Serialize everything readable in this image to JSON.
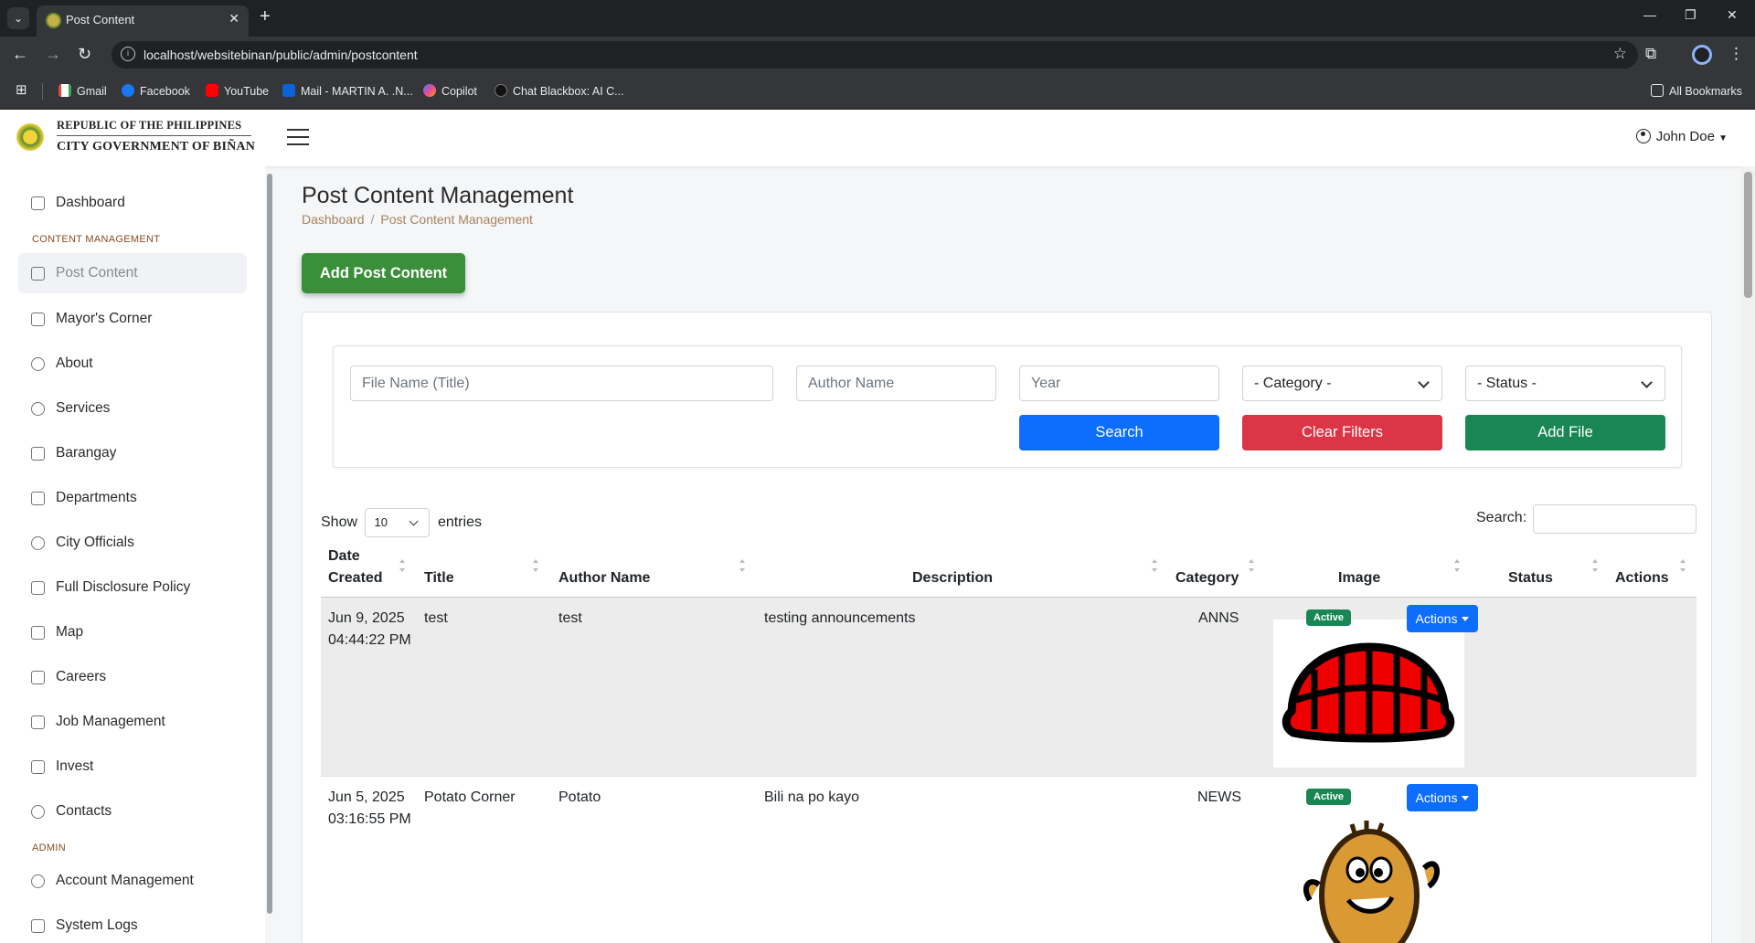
{
  "browser": {
    "tab_title": "Post Content",
    "url": "localhost/websitebinan/public/admin/postcontent",
    "bookmarks": [
      "Gmail",
      "Facebook",
      "YouTube",
      "Mail - MARTIN A. .N...",
      "Copilot",
      "Chat Blackbox: AI C..."
    ],
    "all_bookmarks": "All Bookmarks"
  },
  "header": {
    "brand_line1": "REPUBLIC OF THE PHILIPPINES",
    "brand_line2": "CITY GOVERNMENT OF BIÑAN",
    "user_name": "John Doe"
  },
  "sidebar": {
    "items": [
      {
        "label": "Dashboard",
        "icon": "grid-icon"
      },
      {
        "label": "Post Content",
        "icon": "newspaper-icon"
      },
      {
        "label": "Mayor's Corner",
        "icon": "person-badge-icon"
      },
      {
        "label": "About",
        "icon": "info-icon"
      },
      {
        "label": "Services",
        "icon": "check-circle-icon"
      },
      {
        "label": "Barangay",
        "icon": "house-icon"
      },
      {
        "label": "Departments",
        "icon": "bank-icon"
      },
      {
        "label": "City Officials",
        "icon": "people-icon"
      },
      {
        "label": "Full Disclosure Policy",
        "icon": "list-icon"
      },
      {
        "label": "Map",
        "icon": "map-icon"
      },
      {
        "label": "Careers",
        "icon": "briefcase-icon"
      },
      {
        "label": "Job Management",
        "icon": "person-card-icon"
      },
      {
        "label": "Invest",
        "icon": "cash-icon"
      },
      {
        "label": "Contacts",
        "icon": "phone-icon"
      },
      {
        "label": "Account Management",
        "icon": "person-gear-icon"
      },
      {
        "label": "System Logs",
        "icon": "shield-icon"
      }
    ],
    "headings": {
      "content": "CONTENT MANAGEMENT",
      "admin": "ADMIN"
    }
  },
  "main": {
    "title": "Post Content Management",
    "breadcrumb": [
      "Dashboard",
      "Post Content Management"
    ],
    "add_button": "Add Post Content"
  },
  "filters": {
    "file_name_placeholder": "File Name (Title)",
    "author_placeholder": "Author Name",
    "year_placeholder": "Year",
    "category_selected": "- Category -",
    "status_selected": "- Status -",
    "search_label": "Search",
    "clear_label": "Clear Filters",
    "add_file_label": "Add File"
  },
  "table": {
    "show_label": "Show",
    "entries_value": "10",
    "entries_label": "entries",
    "search_label": "Search:",
    "columns": [
      "Date Created",
      "Title",
      "Author Name",
      "Description",
      "Category",
      "Image",
      "Status",
      "Actions"
    ],
    "rows": [
      {
        "date": "Jun 9, 2025 04:44:22 PM",
        "title": "test",
        "author": "test",
        "description": "testing announcements",
        "category": "ANNS",
        "status": "Active",
        "actions": "Actions"
      },
      {
        "date": "Jun 5, 2025 03:16:55 PM",
        "title": "Potato Corner",
        "author": "Potato",
        "description": "Bili na po kayo",
        "category": "NEWS",
        "status": "Active",
        "actions": "Actions"
      }
    ]
  },
  "colors": {
    "primary": "#0d6efd",
    "danger": "#dc3545",
    "success": "#198754",
    "add_post": "#3b8f3b"
  }
}
